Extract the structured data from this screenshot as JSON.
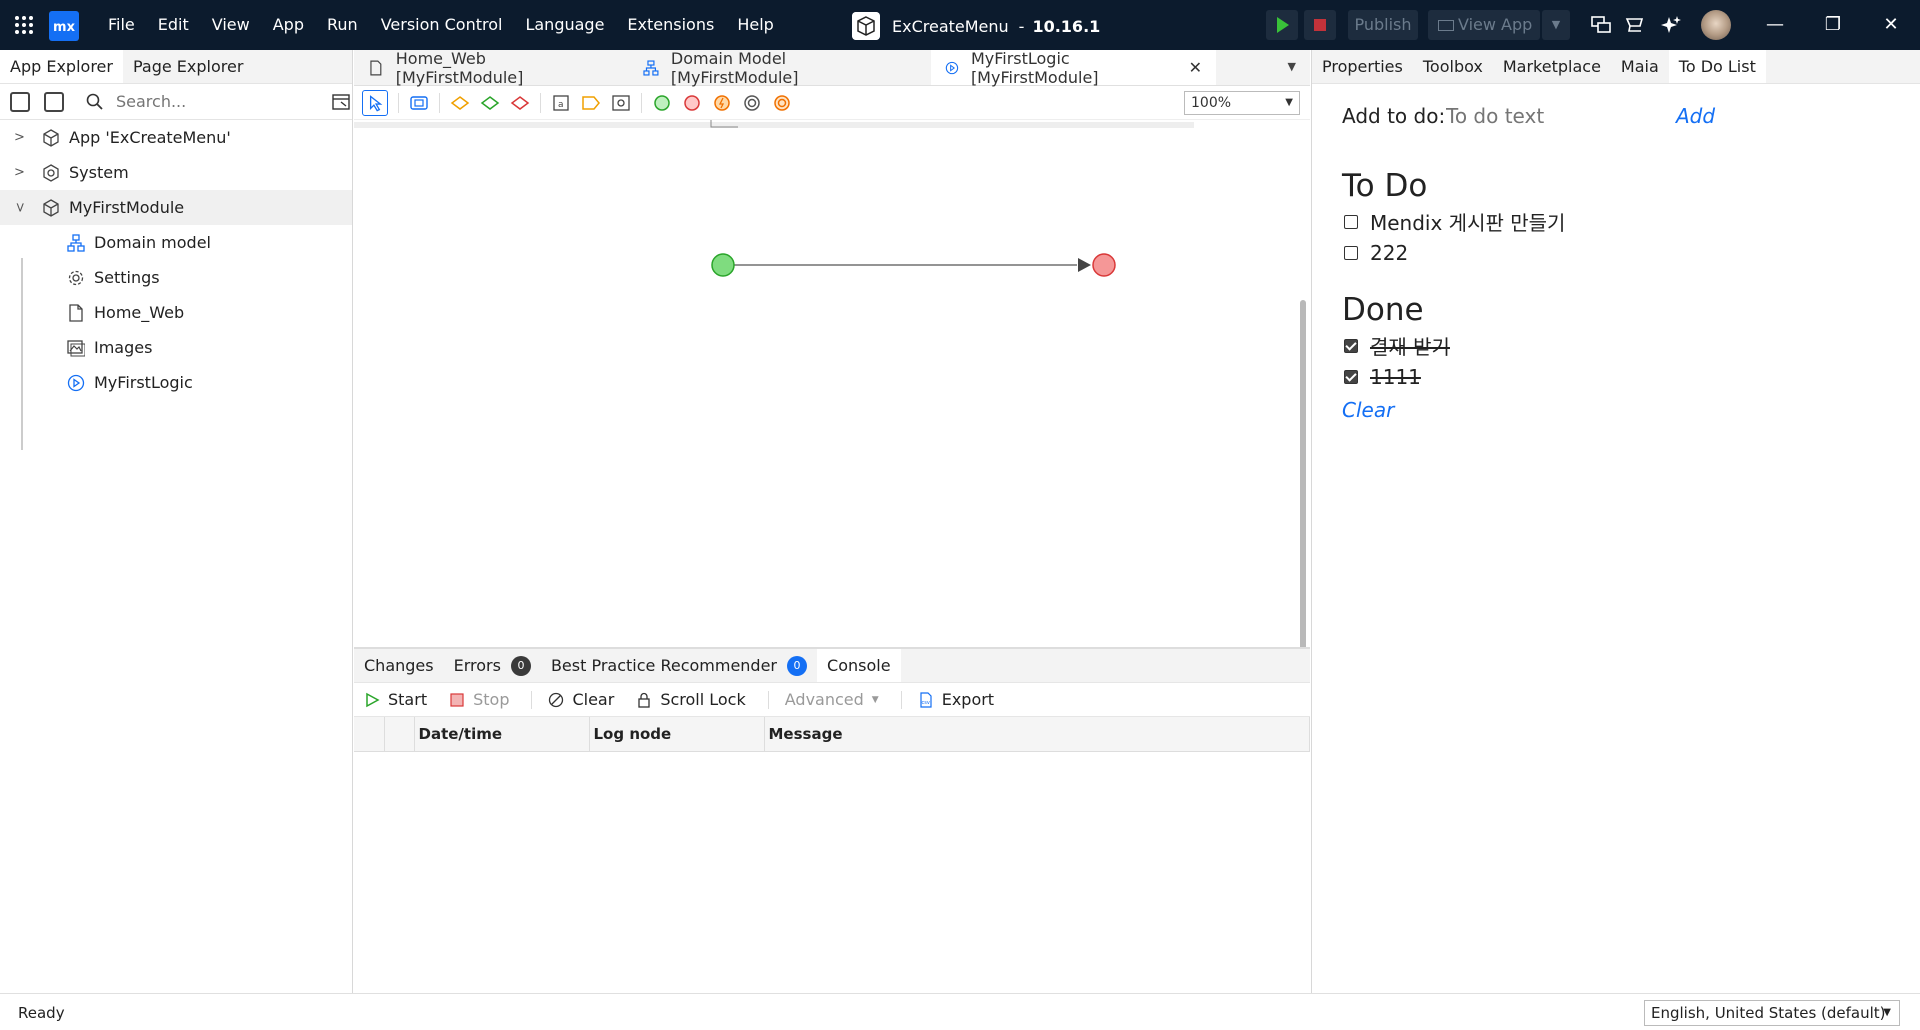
{
  "titlebar": {
    "logo": "mx",
    "menu": [
      "File",
      "Edit",
      "View",
      "App",
      "Run",
      "Version Control",
      "Language",
      "Extensions",
      "Help"
    ],
    "app_name": "ExCreateMenu",
    "separator": "-",
    "version": "10.16.1",
    "publish_label": "Publish",
    "view_app_label": "View App",
    "colors": {
      "background": "#0c1b2d",
      "run": "#39c239",
      "stop": "#c2323a",
      "accent": "#146ff4"
    }
  },
  "left_panel": {
    "tabs": [
      "App Explorer",
      "Page Explorer"
    ],
    "search_placeholder": "Search...",
    "tree": {
      "app": "App 'ExCreateMenu'",
      "system": "System",
      "module": "MyFirstModule",
      "children": [
        "Domain model",
        "Settings",
        "Home_Web",
        "Images",
        "MyFirstLogic"
      ]
    }
  },
  "center": {
    "doc_tabs": [
      "Home_Web [MyFirstModule]",
      "Domain Model [MyFirstModule]",
      "MyFirstLogic [MyFirstModule]"
    ],
    "zoom": "100%",
    "microflow": {
      "start_color": "#7fdc7f",
      "end_color": "#f59797"
    }
  },
  "bottom_panel": {
    "tabs": {
      "changes": "Changes",
      "errors": "Errors",
      "errors_count": "0",
      "best_practice": "Best Practice Recommender",
      "best_practice_count": "0",
      "console": "Console"
    },
    "console_buttons": {
      "start": "Start",
      "stop": "Stop",
      "clear": "Clear",
      "scroll_lock": "Scroll Lock",
      "advanced": "Advanced",
      "export": "Export"
    },
    "columns": [
      "Date/time",
      "Log node",
      "Message"
    ]
  },
  "right_panel": {
    "tabs": [
      "Properties",
      "Toolbox",
      "Marketplace",
      "Maia",
      "To Do List"
    ],
    "todo": {
      "add_label": "Add to do:",
      "input_placeholder": "To do text",
      "add_button": "Add",
      "todo_heading": "To Do",
      "todo_items": [
        "Mendix 게시판 만들기",
        "222"
      ],
      "done_heading": "Done",
      "done_items": [
        "결재 받기",
        "1111"
      ],
      "clear_button": "Clear"
    }
  },
  "statusbar": {
    "status": "Ready",
    "language": "English, United States (default)"
  }
}
